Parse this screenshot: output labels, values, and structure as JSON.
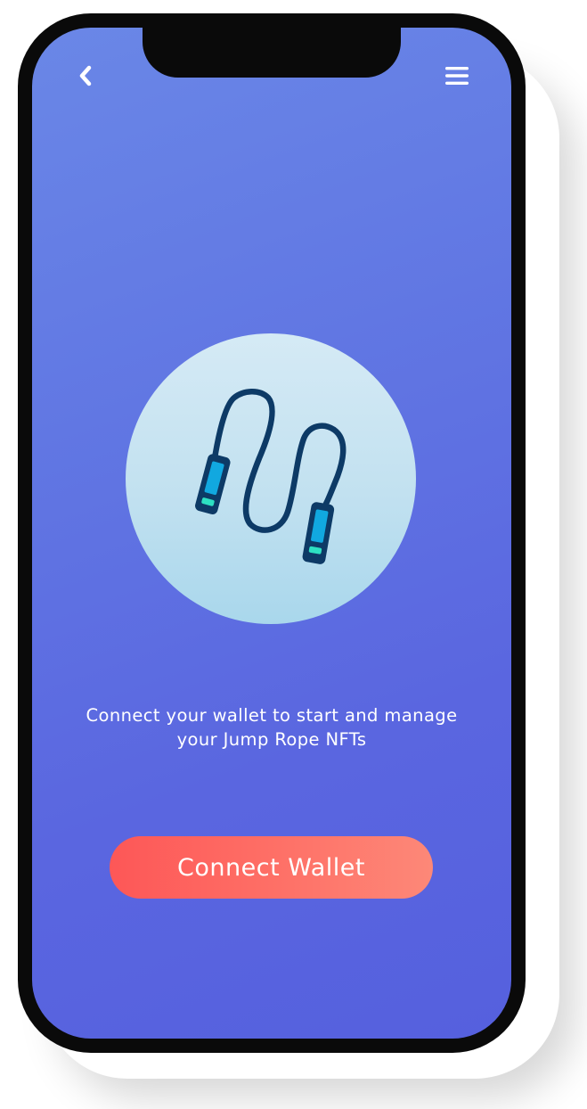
{
  "nav": {
    "back_icon": "chevron-left-icon",
    "menu_icon": "hamburger-menu-icon"
  },
  "illustration": {
    "icon": "jump-rope-icon"
  },
  "main": {
    "message_line1": "Connect your wallet to start and manage",
    "message_line2": "your Jump Rope NFTs",
    "connect_button_label": "Connect Wallet"
  },
  "colors": {
    "background_gradient_top": "#6a87e7",
    "background_gradient_bottom": "#5560de",
    "button_gradient_start": "#fd5757",
    "button_gradient_end": "#fd8878",
    "illustration_circle": "#c2e1f0",
    "rope": "#0d3a66",
    "handle_fill": "#11a8e0",
    "handle_tip": "#2de0c2"
  }
}
